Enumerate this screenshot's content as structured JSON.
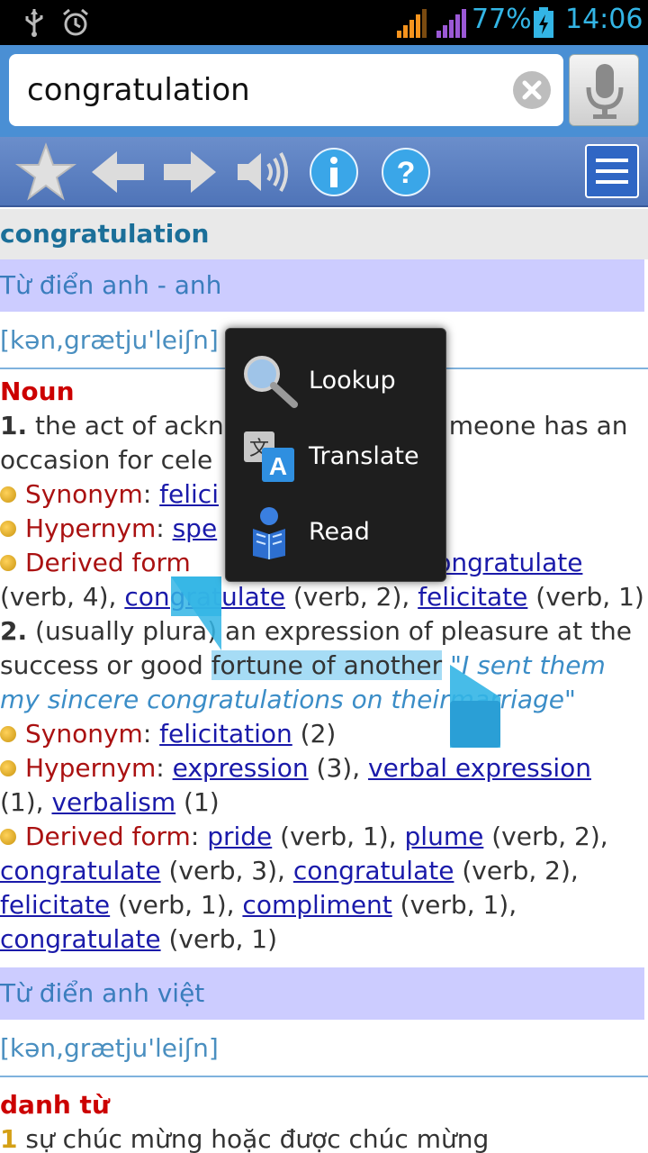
{
  "status_bar": {
    "battery_percent": "77%",
    "time": "14:06",
    "icons": [
      "usb-icon",
      "alarm-icon",
      "signal-icon",
      "signal-icon",
      "battery-charging-icon"
    ]
  },
  "search": {
    "query": "congratulation",
    "icons": [
      "clear-icon",
      "microphone-icon"
    ]
  },
  "toolbar": {
    "icons": [
      "star-icon",
      "back-arrow-icon",
      "forward-arrow-icon",
      "speaker-icon",
      "info-icon",
      "help-icon",
      "menu-icon"
    ]
  },
  "entry": {
    "word": "congratulation",
    "dict1": {
      "header": "Từ điển anh - anh",
      "phonetic": "[kən,grætju'leiʃn]",
      "pos": "Noun",
      "sense1": {
        "num": "1.",
        "text_a": " the act of ackn",
        "text_b": "meone has an",
        "text_c": "occasion for cele",
        "syn_label": "Synonym",
        "syn_link": "felici",
        "hyp_label": "Hypernym",
        "hyp_link": "spe",
        "der_label": "Derived form",
        "der_link_1": "congratulate",
        "der_suffix_1": "(verb, 4), ",
        "der_link_2": "congratulate",
        "der_mid_2": " (verb, 2), ",
        "der_link_3": "felicitate",
        "der_tail_3": " (verb, 1)"
      },
      "sense2": {
        "num": "2.",
        "text_a": " (usually plura",
        "text_b": ") an expression of pleasure at the",
        "text_c": "success or good ",
        "highlight": "fortune of another",
        "text_d": " ",
        "example_a": "\"I sent them",
        "example_b": "my sincere congratulations on their",
        "example_c": "marriage\"",
        "syn_label": "Synonym",
        "syn_link": "felicitation",
        "syn_suffix": " (2)",
        "hyp_label": "Hypernym",
        "hyp_link_1": "expression",
        "hyp_mid_1": " (3), ",
        "hyp_link_2": "verbal expression",
        "hyp_pre_3": "(1), ",
        "hyp_link_3": "verbalism",
        "hyp_suffix_3": " (1)",
        "der_label": "Derived form",
        "der_link_1": "pride",
        "der_mid_1": " (verb, 1), ",
        "der_link_2": "plume",
        "der_mid_2": " (verb, 2),",
        "der_link_3": "congratulate",
        "der_mid_3": " (verb, 3), ",
        "der_link_4": "congratulate",
        "der_mid_4": " (verb, 2),",
        "der_link_5": "felicitate",
        "der_mid_5": " (verb, 1), ",
        "der_link_6": "compliment",
        "der_mid_6": " (verb, 1),",
        "der_link_7": "congratulate",
        "der_mid_7": " (verb, 1)"
      }
    },
    "dict2": {
      "header": "Từ điển anh việt",
      "phonetic": "[kən,grætju'leiʃn]",
      "pos": "danh từ",
      "sense1_num": "1",
      "sense1_text": " sự chúc mừng hoặc được chúc mừng"
    }
  },
  "popup_menu": {
    "items": [
      {
        "label": "Lookup",
        "icon": "magnifier-icon"
      },
      {
        "label": "Translate",
        "icon": "translate-icon"
      },
      {
        "label": "Read",
        "icon": "reader-icon"
      }
    ]
  },
  "colors": {
    "accent": "#33b5e5",
    "toolbar": "#5b80c2",
    "dict_header_bg": "#ccccff",
    "pos_red": "#cc0000",
    "link": "#1a1aaa",
    "selection": "#a6dcf5"
  }
}
